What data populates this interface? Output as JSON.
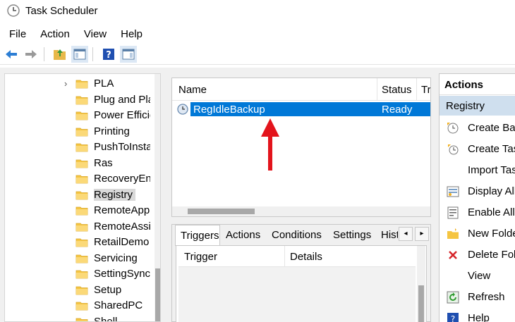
{
  "window": {
    "title": "Task Scheduler"
  },
  "menu": [
    "File",
    "Action",
    "View",
    "Help"
  ],
  "toolbar": {
    "icons": [
      "back-arrow-icon",
      "forward-arrow-icon",
      "up-folder-icon",
      "show-hide-tree-icon",
      "help-icon",
      "show-hide-action-pane-icon"
    ]
  },
  "tree": {
    "items": [
      {
        "label": "PLA",
        "expandable": true
      },
      {
        "label": "Plug and Play",
        "expandable": false
      },
      {
        "label": "Power Efficiency",
        "expandable": false
      },
      {
        "label": "Printing",
        "expandable": false
      },
      {
        "label": "PushToInstall",
        "expandable": false
      },
      {
        "label": "Ras",
        "expandable": false
      },
      {
        "label": "RecoveryEnvironment",
        "expandable": false
      },
      {
        "label": "Registry",
        "expandable": false,
        "selected": true
      },
      {
        "label": "RemoteApp",
        "expandable": false
      },
      {
        "label": "RemoteAssistance",
        "expandable": false
      },
      {
        "label": "RetailDemo",
        "expandable": false
      },
      {
        "label": "Servicing",
        "expandable": false
      },
      {
        "label": "SettingSync",
        "expandable": false
      },
      {
        "label": "Setup",
        "expandable": false
      },
      {
        "label": "SharedPC",
        "expandable": false
      },
      {
        "label": "Shell",
        "expandable": false
      }
    ]
  },
  "tasklist": {
    "columns": {
      "name": "Name",
      "status": "Status",
      "triggers": "Tr"
    },
    "rows": [
      {
        "name": "RegIdleBackup",
        "status": "Ready"
      }
    ]
  },
  "tabs": {
    "items": [
      "Triggers",
      "Actions",
      "Conditions",
      "Settings",
      "Hist"
    ],
    "active": "Triggers",
    "grid_columns": {
      "trigger": "Trigger",
      "details": "Details"
    }
  },
  "actions": {
    "header": "Actions",
    "section": "Registry",
    "items": [
      {
        "label": "Create Basic Task",
        "icon": "create-basic-task-icon"
      },
      {
        "label": "Create Task",
        "icon": "create-task-icon"
      },
      {
        "label": "Import Task",
        "icon": ""
      },
      {
        "label": "Display All Running Tasks",
        "icon": "display-running-icon"
      },
      {
        "label": "Enable All Tasks History",
        "icon": "enable-history-icon"
      },
      {
        "label": "New Folder",
        "icon": "new-folder-icon"
      },
      {
        "label": "Delete Folder",
        "icon": "delete-icon"
      },
      {
        "label": "View",
        "icon": ""
      },
      {
        "label": "Refresh",
        "icon": "refresh-icon"
      },
      {
        "label": "Help",
        "icon": "help-icon"
      }
    ]
  },
  "colors": {
    "selection": "#0078d7",
    "annotation_arrow": "#e3141c",
    "folder": "#f5c542"
  }
}
